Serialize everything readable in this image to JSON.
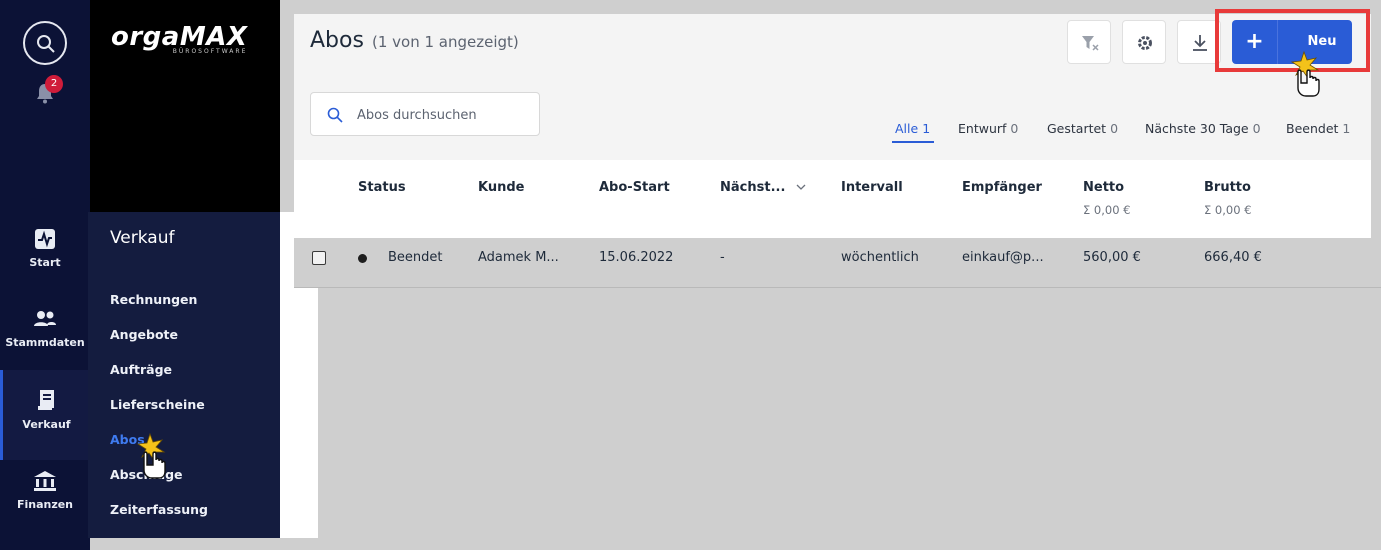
{
  "rail": {
    "notifications_count": "2",
    "items": [
      {
        "label": "Start"
      },
      {
        "label": "Stammdaten"
      },
      {
        "label": "Verkauf"
      },
      {
        "label": "Finanzen"
      }
    ]
  },
  "brand": {
    "logo_orga": "orga",
    "logo_max": "MAX",
    "logo_sub": "BÜROSOFTWARE"
  },
  "subnav": {
    "title": "Verkauf",
    "items": [
      "Rechnungen",
      "Angebote",
      "Aufträge",
      "Lieferscheine",
      "Abos",
      "Abschläge",
      "Zeiterfassung"
    ]
  },
  "header": {
    "title": "Abos",
    "subtitle": "(1 von 1 angezeigt)",
    "new_label": "Neu",
    "new_plus": "+"
  },
  "search": {
    "placeholder": "Abos durchsuchen"
  },
  "filters": [
    {
      "label": "Alle",
      "count": "1"
    },
    {
      "label": "Entwurf",
      "count": "0"
    },
    {
      "label": "Gestartet",
      "count": "0"
    },
    {
      "label": "Nächste 30 Tage",
      "count": "0"
    },
    {
      "label": "Beendet",
      "count": "1"
    }
  ],
  "table": {
    "columns": {
      "status": "Status",
      "kunde": "Kunde",
      "abo_start": "Abo-Start",
      "naechste": "Nächst...",
      "intervall": "Intervall",
      "empfaenger": "Empfänger",
      "netto": "Netto",
      "brutto": "Brutto"
    },
    "sums": {
      "netto": "Σ 0,00 €",
      "brutto": "Σ 0,00 €"
    },
    "rows": [
      {
        "status": "Beendet",
        "kunde": "Adamek M...",
        "abo_start": "15.06.2022",
        "naechste": "-",
        "intervall": "wöchentlich",
        "empfaenger": "einkauf@p...",
        "netto": "560,00 €",
        "brutto": "666,40 €"
      }
    ]
  },
  "colors": {
    "accent": "#2a5cd6",
    "highlight": "#e83a3a",
    "rail": "#0c1236",
    "badge": "#d01c3a"
  }
}
